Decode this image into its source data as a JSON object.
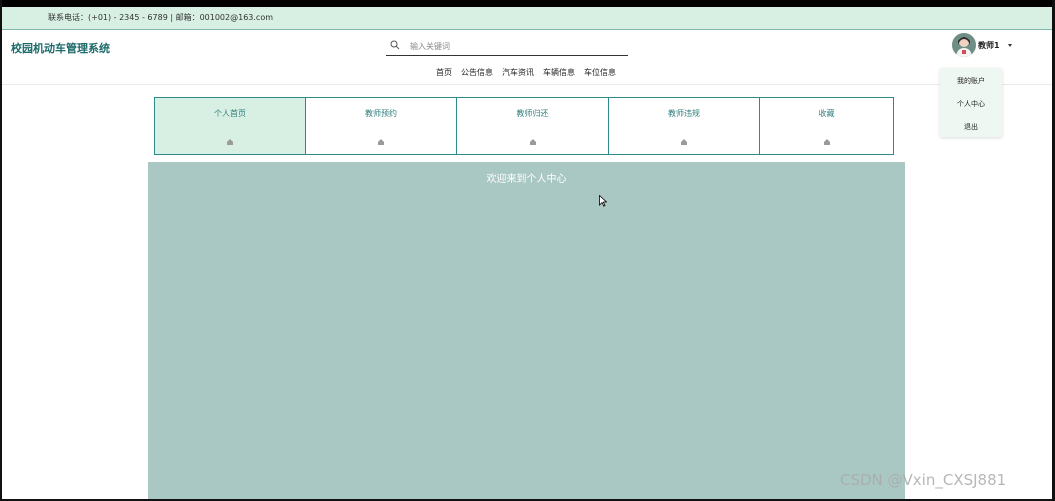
{
  "topbar": {
    "contact": "联系电话：(+01) - 2345 - 6789 | 邮箱：001002@163.com"
  },
  "header": {
    "brand": "校园机动车管理系统",
    "search": {
      "placeholder": "输入关键词",
      "icon": "search-icon"
    }
  },
  "nav": {
    "items": [
      "首页",
      "公告信息",
      "汽车资讯",
      "车辆信息",
      "车位信息"
    ]
  },
  "user": {
    "name": "教师1",
    "avatar": "avatar",
    "caret_icon": "caret-down-icon"
  },
  "dropdown": {
    "items": [
      "我的账户",
      "个人中心",
      "退出"
    ]
  },
  "tabs": {
    "items": [
      {
        "label": "个人首页",
        "active": true
      },
      {
        "label": "教师预约",
        "active": false
      },
      {
        "label": "教师归还",
        "active": false
      },
      {
        "label": "教师违规",
        "active": false
      },
      {
        "label": "收藏",
        "active": false
      }
    ]
  },
  "panel": {
    "welcome": "欢迎来到个人中心"
  },
  "watermark": "CSDN @Vxin_CXSJ881",
  "colors": {
    "accent": "#2e8a8a",
    "topbar_bg": "#d8efe4",
    "panel_bg": "#a9c8c3",
    "brand": "#1d6a6a"
  }
}
